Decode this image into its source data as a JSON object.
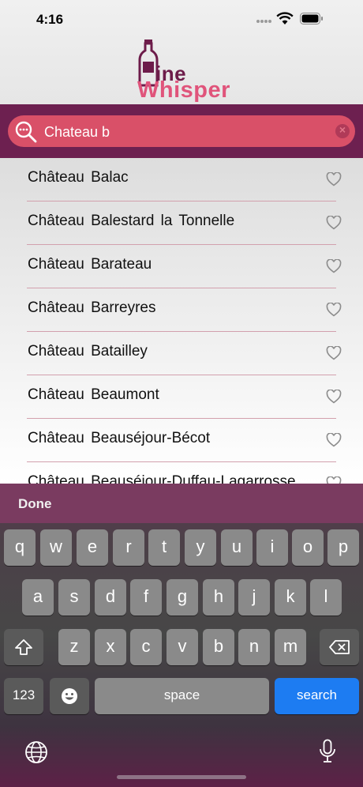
{
  "status_bar": {
    "time": "4:16"
  },
  "app": {
    "logo_line1": "ine",
    "logo_line2": "Whisper",
    "colors": {
      "brand_dark": "#6d2050",
      "brand_pink": "#d95068",
      "accent_blue": "#1d7cf2"
    }
  },
  "search": {
    "value": "Chateau b",
    "icon": "search-icon",
    "clear_icon": "clear-icon"
  },
  "results": [
    {
      "name": "Château Balac"
    },
    {
      "name": "Château Balestard la Tonnelle"
    },
    {
      "name": "Château Barateau"
    },
    {
      "name": "Château Barreyres"
    },
    {
      "name": "Château Batailley"
    },
    {
      "name": "Château Beaumont"
    },
    {
      "name": "Château Beauséjour-Bécot"
    },
    {
      "name": "Château Beauséjour-Duffau-Lagarrosse"
    }
  ],
  "keyboard": {
    "done_label": "Done",
    "row1": [
      "q",
      "w",
      "e",
      "r",
      "t",
      "y",
      "u",
      "i",
      "o",
      "p"
    ],
    "row2": [
      "a",
      "s",
      "d",
      "f",
      "g",
      "h",
      "j",
      "k",
      "l"
    ],
    "row3": [
      "z",
      "x",
      "c",
      "v",
      "b",
      "n",
      "m"
    ],
    "numbers_label": "123",
    "space_label": "space",
    "search_label": "search"
  }
}
